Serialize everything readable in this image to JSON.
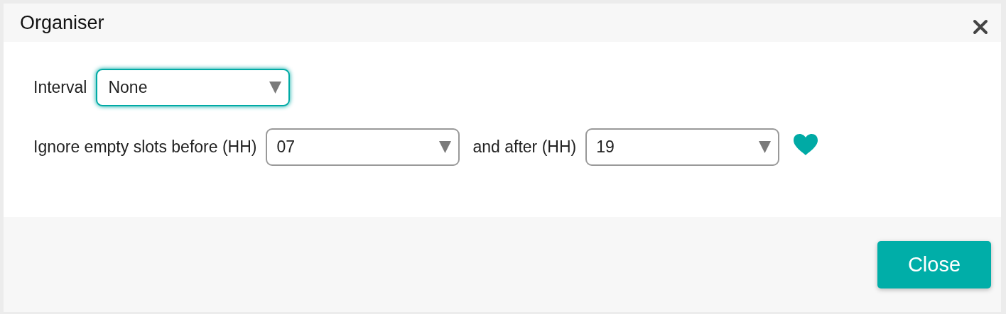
{
  "dialog": {
    "title": "Organiser"
  },
  "rows": [
    {
      "items": [
        {
          "kind": "label",
          "text": "Interval"
        },
        {
          "kind": "select",
          "value": "None",
          "focused": true
        }
      ]
    },
    {
      "items": [
        {
          "kind": "label",
          "text": "Ignore empty slots before (HH)"
        },
        {
          "kind": "select",
          "value": "07",
          "focused": false
        },
        {
          "kind": "label",
          "text": "and after (HH)"
        },
        {
          "kind": "select",
          "value": "19",
          "focused": false
        },
        {
          "kind": "heart"
        }
      ]
    }
  ],
  "buttons": [
    {
      "label": "Close"
    }
  ]
}
